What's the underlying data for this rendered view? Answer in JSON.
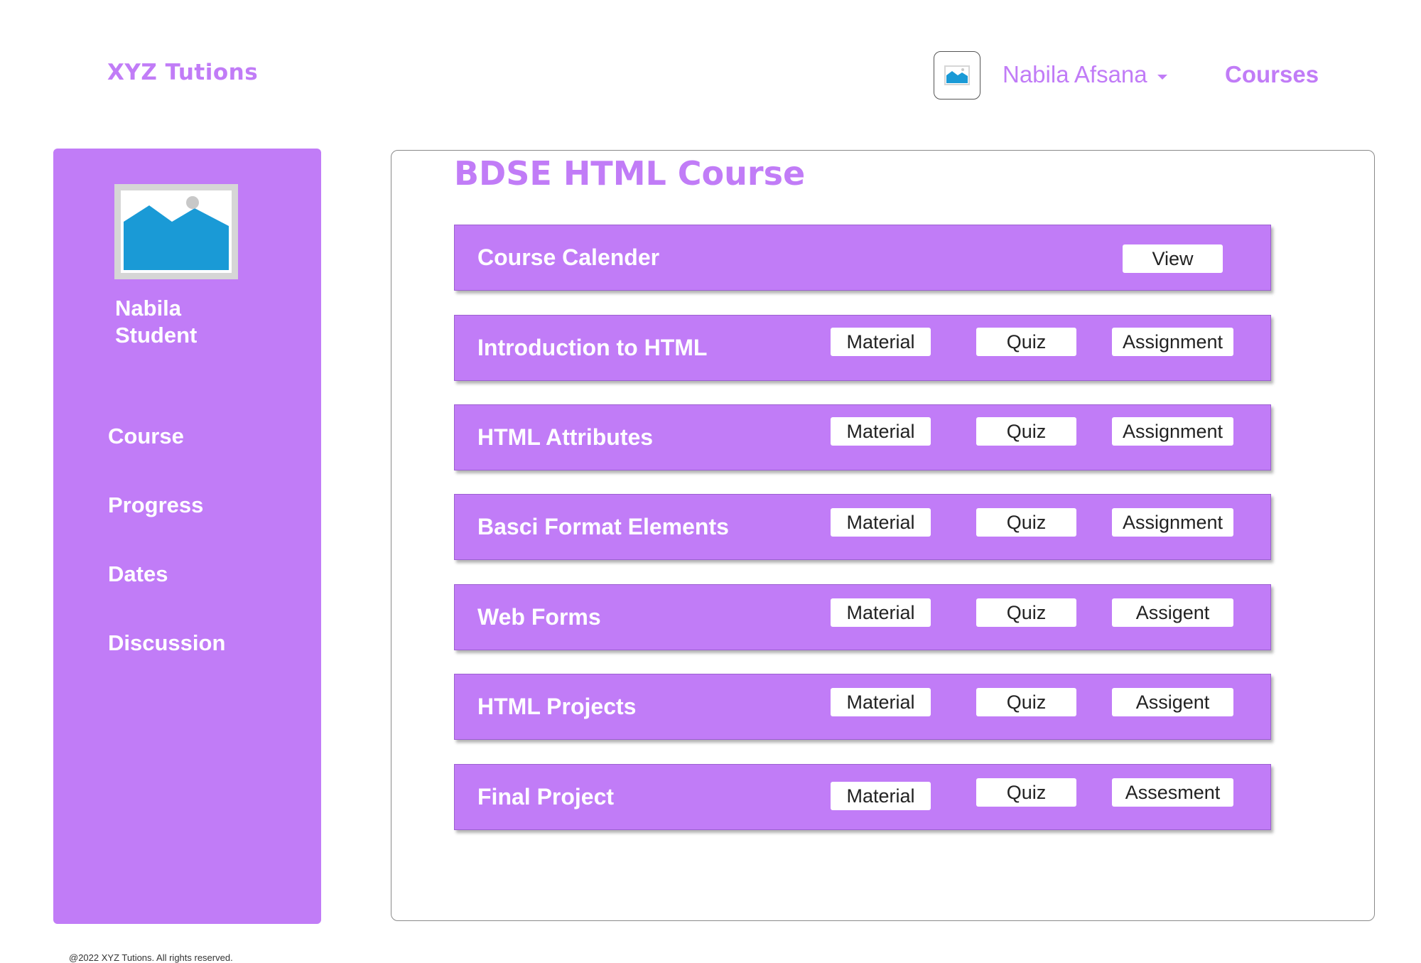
{
  "header": {
    "brand": "XYZ Tutions",
    "user_name": "Nabila Afsana",
    "courses_link": "Courses"
  },
  "sidebar": {
    "profile_name_line1": "Nabila",
    "profile_name_line2": "Student",
    "items": [
      {
        "label": "Course"
      },
      {
        "label": "Progress"
      },
      {
        "label": "Dates"
      },
      {
        "label": "Discussion"
      }
    ]
  },
  "main": {
    "title": "BDSE HTML Course",
    "calendar": {
      "title": "Course Calender",
      "view_label": "View"
    },
    "modules": [
      {
        "title": "Introduction to HTML",
        "material": "Material",
        "quiz": "Quiz",
        "assignment": "Assignment"
      },
      {
        "title": "HTML Attributes",
        "material": "Material",
        "quiz": "Quiz",
        "assignment": "Assignment"
      },
      {
        "title": "Basci Format Elements",
        "material": "Material",
        "quiz": "Quiz",
        "assignment": "Assignment"
      },
      {
        "title": "Web Forms",
        "material": "Material",
        "quiz": "Quiz",
        "assignment": "Assigent"
      },
      {
        "title": "HTML Projects",
        "material": "Material",
        "quiz": "Quiz",
        "assignment": "Assigent"
      },
      {
        "title": "Final Project",
        "material": "Material",
        "quiz": "Quiz",
        "assignment": "Assesment"
      }
    ]
  },
  "footer": {
    "text": "@2022 XYZ Tutions. All rights reserved."
  },
  "colors": {
    "accent": "#c17cf7",
    "image_blue": "#1a9ad6"
  },
  "icons": {
    "avatar": "image-placeholder-icon",
    "dropdown": "caret-down-icon"
  }
}
